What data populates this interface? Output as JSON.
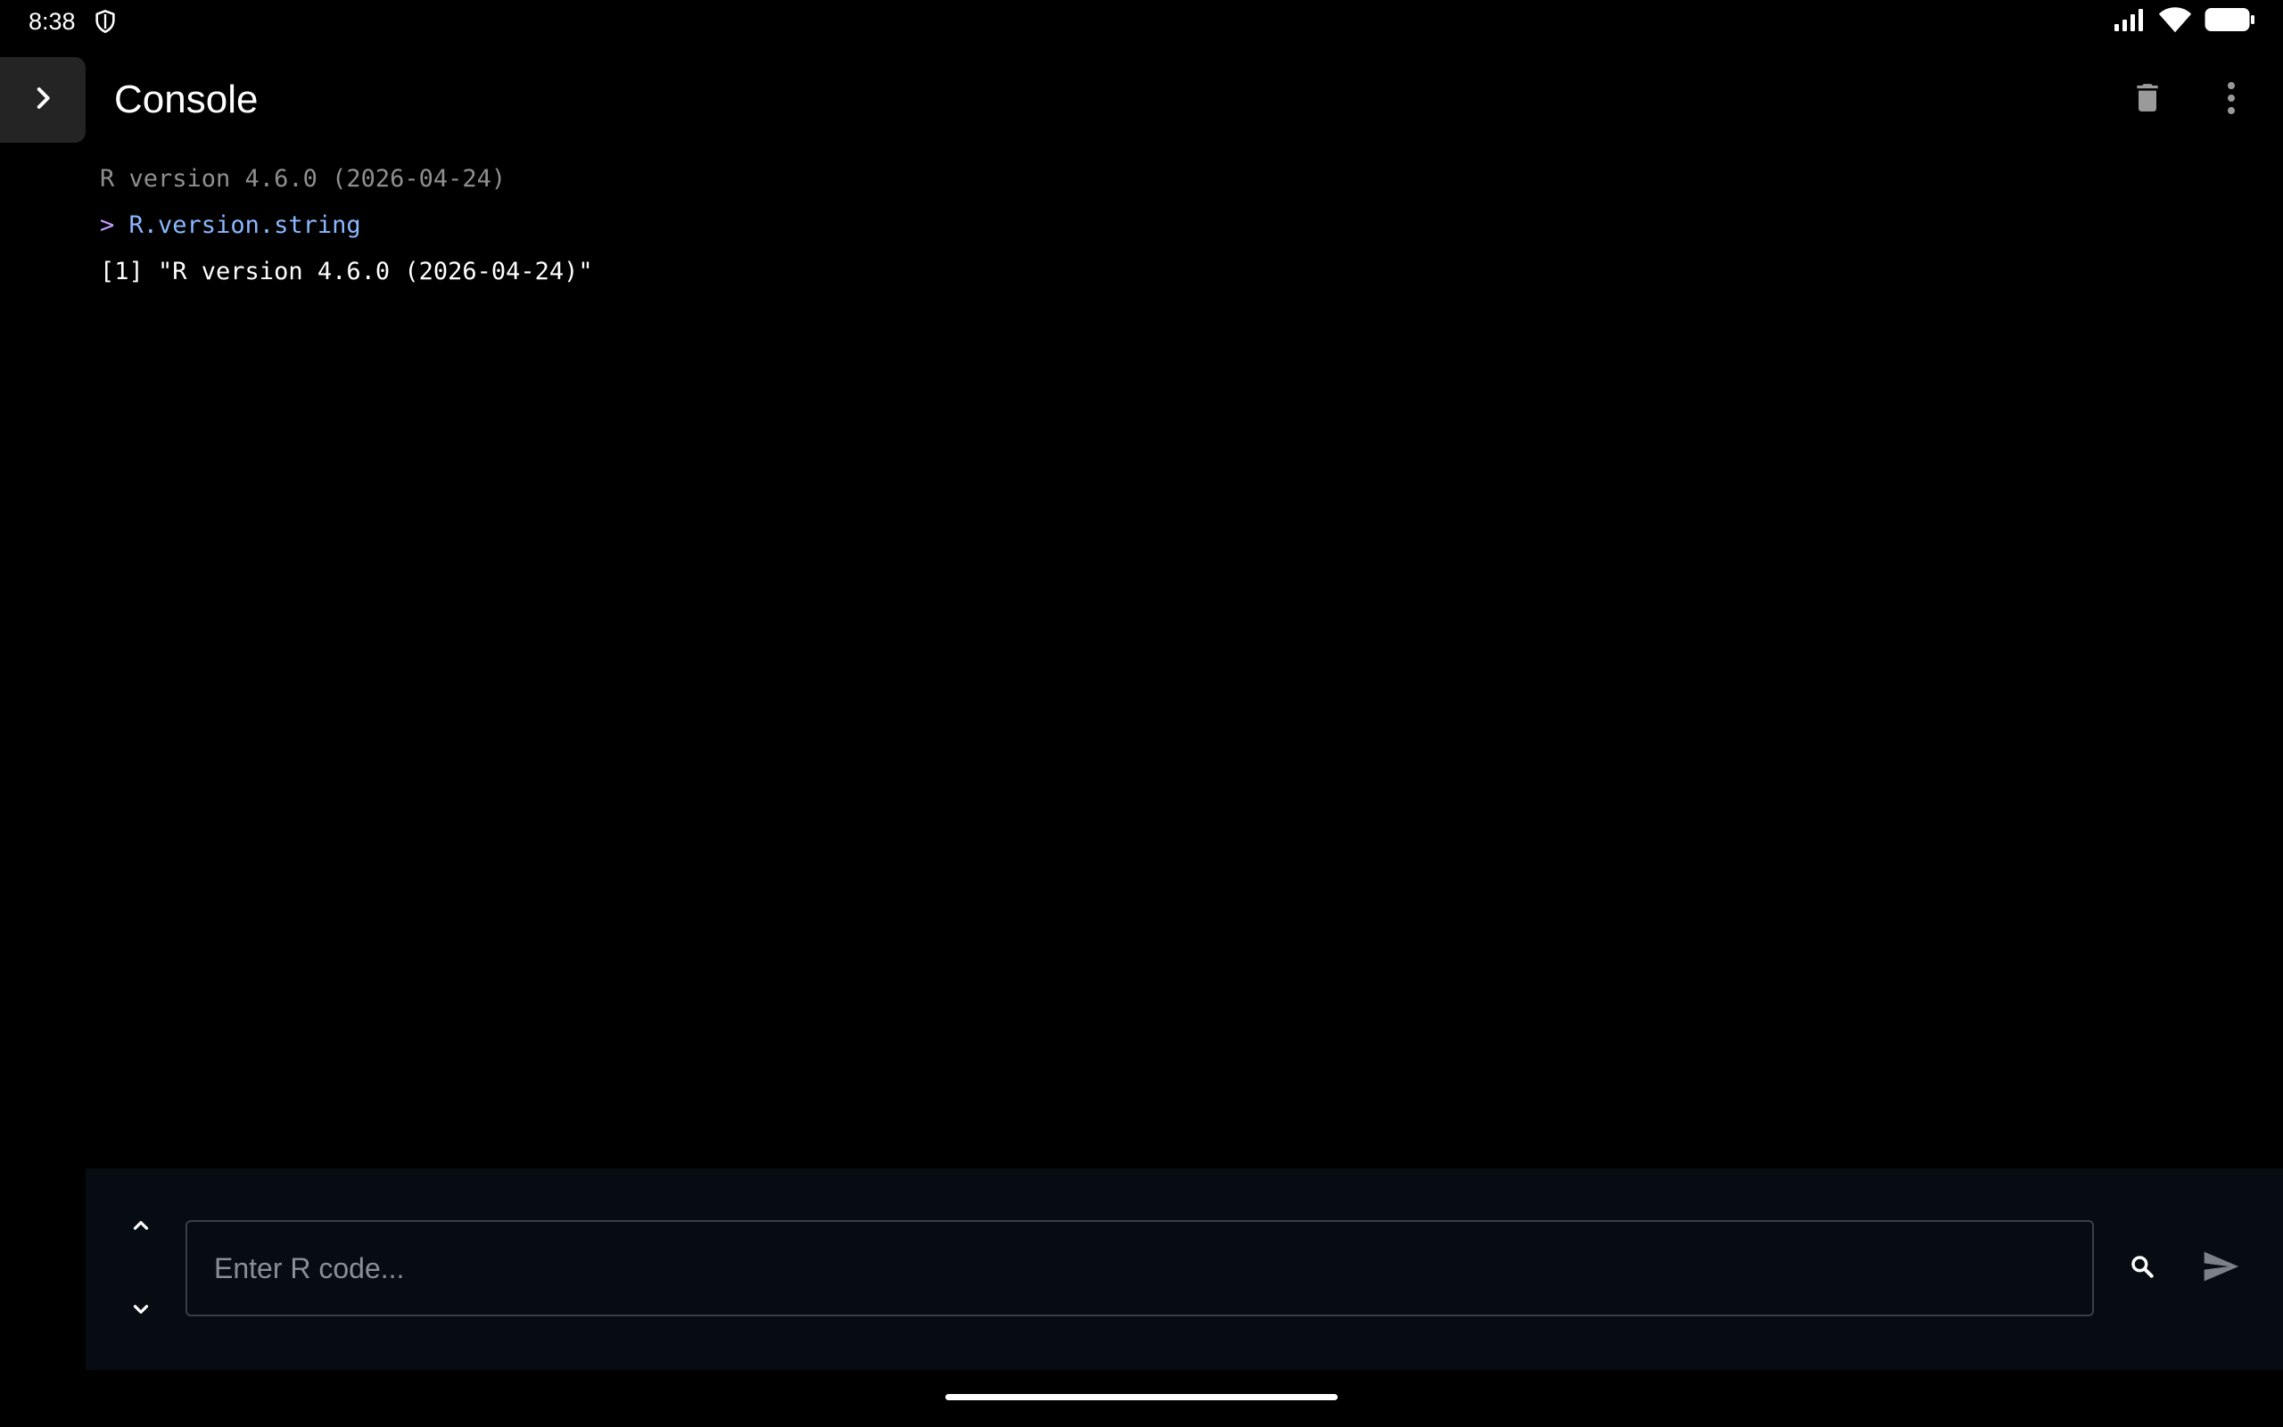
{
  "status_bar": {
    "time": "8:38",
    "icons": [
      "shield-icon",
      "cellular-signal-icon",
      "wifi-icon",
      "battery-icon"
    ]
  },
  "app_bar": {
    "title": "Console",
    "drawer_icon": "chevron-right-icon",
    "actions": [
      "delete-icon",
      "more-vert-icon"
    ]
  },
  "console": {
    "banner": "R version 4.6.0 (2026-04-24)",
    "prompt": ">",
    "command": "R.version.string",
    "result": "[1] \"R version 4.6.0 (2026-04-24)\""
  },
  "input": {
    "placeholder": "Enter R code...",
    "value": "",
    "history_up_icon": "chevron-up-icon",
    "history_down_icon": "chevron-down-icon",
    "search_icon": "search-icon",
    "send_icon": "send-icon"
  },
  "colors": {
    "background": "#000000",
    "input_panel": "#070c12",
    "banner_text": "#8f8f8f",
    "prompt": "#c39cff",
    "command": "#8ab8ff",
    "result_text": "#ffffff",
    "toggle_bg": "#242424"
  }
}
